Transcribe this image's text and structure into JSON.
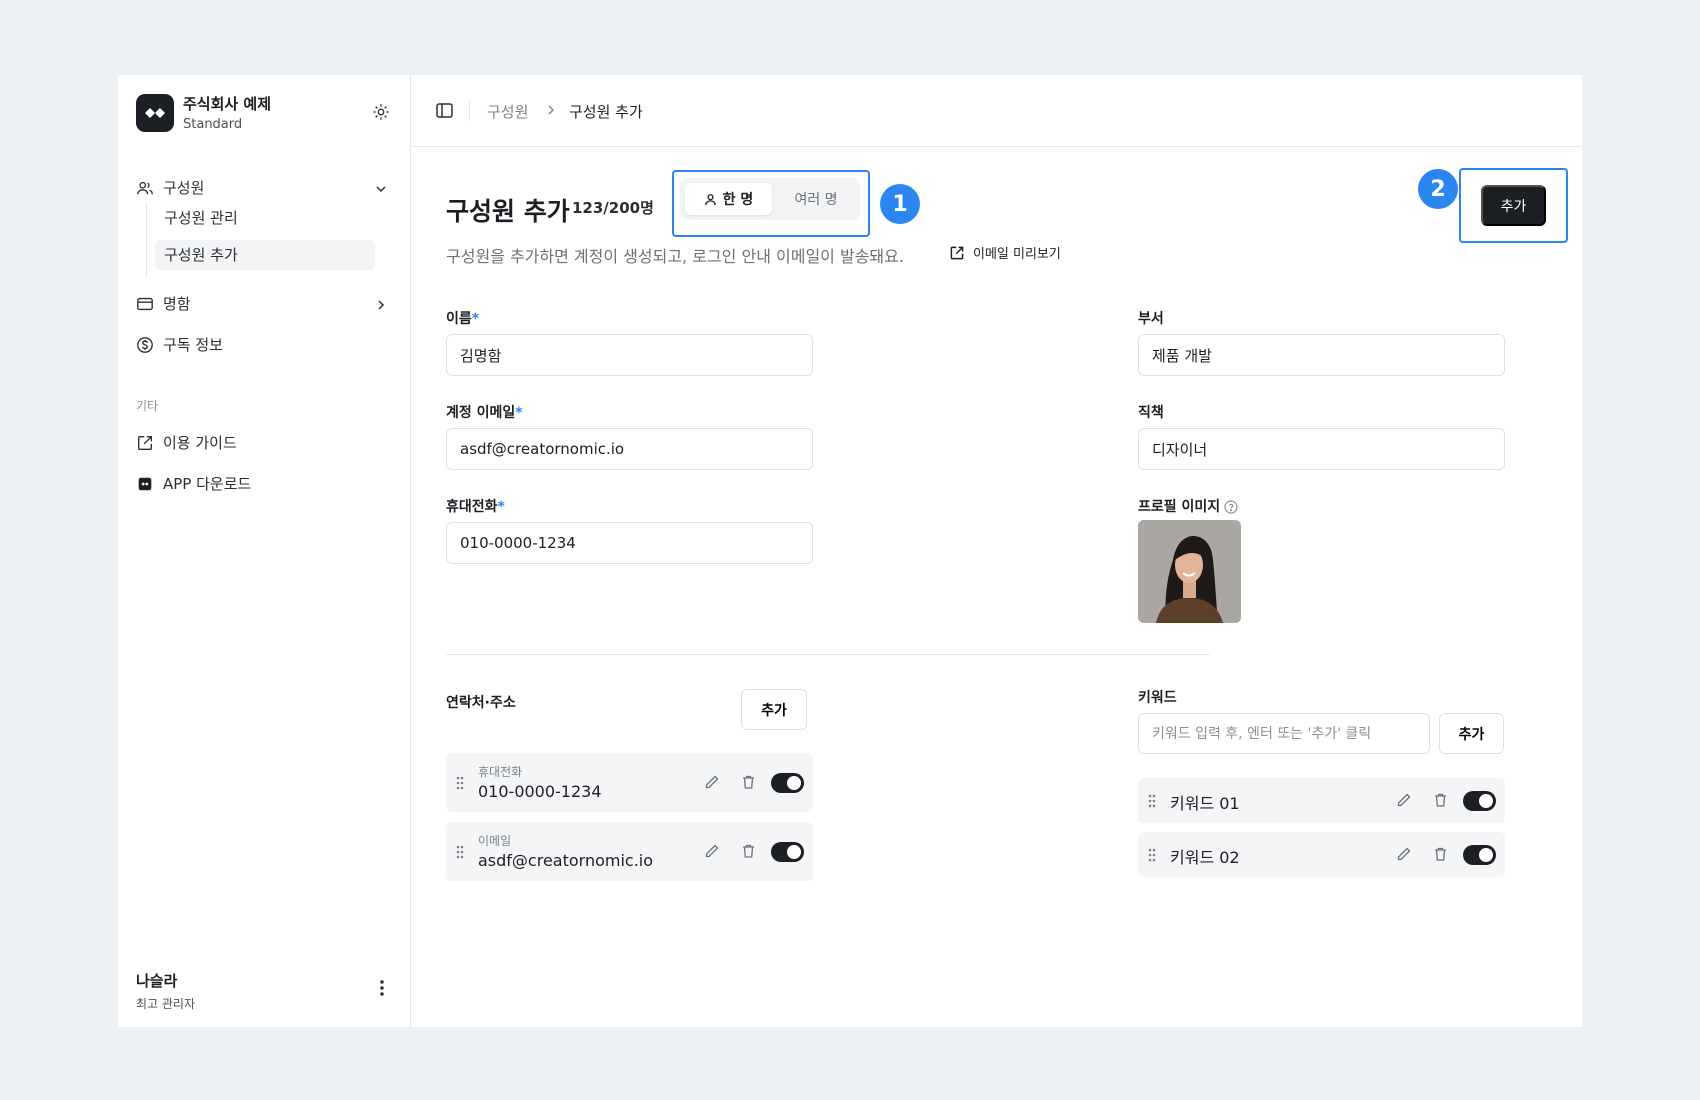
{
  "sidebar": {
    "org_name": "주식회사 예제",
    "org_plan": "Standard",
    "nav": {
      "members": "구성원",
      "members_manage": "구성원 관리",
      "members_add": "구성원 추가",
      "cards": "명함",
      "subscription": "구독 정보"
    },
    "section_etc": "기타",
    "guide": "이용 가이드",
    "app_download": "APP 다운로드",
    "user_name": "나슬라",
    "user_role": "최고 관리자"
  },
  "breadcrumb": {
    "parent": "구성원",
    "current": "구성원 추가"
  },
  "header": {
    "title": "구성원 추가",
    "count": "123/200명",
    "mode_single": "한 명",
    "mode_multi": "여러 명",
    "badge_1": "1",
    "badge_2": "2",
    "add_label": "추가",
    "description": "구성원을 추가하면 계정이 생성되고, 로그인 안내 이메일이 발송돼요.",
    "email_preview": "이메일 미리보기"
  },
  "form": {
    "name_label": "이름",
    "name_value": "김명함",
    "dept_label": "부서",
    "dept_value": "제품 개발",
    "email_label": "계정 이메일",
    "email_value": "asdf@creatornomic.io",
    "title_label": "직책",
    "title_value": "디자이너",
    "phone_label": "휴대전화",
    "phone_value": "010-0000-1234",
    "photo_label": "프로필 이미지",
    "required_mark": "*"
  },
  "contacts": {
    "title": "연락처·주소",
    "add_label": "추가",
    "items": [
      {
        "label": "휴대전화",
        "value": "010-0000-1234",
        "enabled": true
      },
      {
        "label": "이메일",
        "value": "asdf@creatornomic.io",
        "enabled": true
      }
    ]
  },
  "keywords": {
    "title": "키워드",
    "placeholder": "키워드 입력 후, 엔터 또는 '추가' 클릭",
    "add_label": "추가",
    "items": [
      {
        "value": "키워드 01",
        "enabled": true
      },
      {
        "value": "키워드 02",
        "enabled": true
      }
    ]
  },
  "colors": {
    "accent": "#2b86f0",
    "dark": "#1c1f23"
  },
  "icons": [
    "gear-icon",
    "users-icon",
    "chevron-down-icon",
    "card-icon",
    "chevron-right-icon",
    "dollar-circle-icon",
    "external-link-icon",
    "app-icon",
    "kebab-icon",
    "sidebar-panel-icon",
    "person-icon",
    "help-icon",
    "grip-icon",
    "pencil-icon",
    "trash-icon"
  ]
}
